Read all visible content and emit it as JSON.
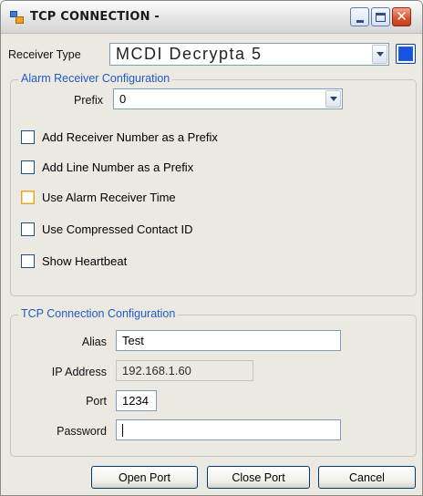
{
  "window": {
    "title": "TCP CONNECTION -",
    "icons": {
      "app": "app-window-icon",
      "minimize": "minimize-icon",
      "maximize": "maximize-icon",
      "close": "close-icon"
    }
  },
  "receiver_type": {
    "label": "Receiver Type",
    "value": "MCDI Decrypta 5",
    "color_button": "#1b5ee8"
  },
  "alarm_config": {
    "legend": "Alarm Receiver Configuration",
    "prefix_label": "Prefix",
    "prefix_value": "0",
    "checkboxes": [
      {
        "label": "Add Receiver Number as a Prefix",
        "checked": false
      },
      {
        "label": "Add Line Number as a Prefix",
        "checked": false
      },
      {
        "label": "Use Alarm Receiver Time",
        "checked": false
      },
      {
        "label": "Use Compressed Contact ID",
        "checked": false
      },
      {
        "label": "Show Heartbeat",
        "checked": false
      }
    ]
  },
  "tcp_config": {
    "legend": "TCP Connection Configuration",
    "alias_label": "Alias",
    "alias_value": "Test",
    "ip_label": "IP Address",
    "ip_value": "192.168.1.60",
    "port_label": "Port",
    "port_value": "1234",
    "password_label": "Password",
    "password_value": ""
  },
  "buttons": {
    "open_port": "Open Port",
    "close_port": "Close Port",
    "cancel": "Cancel"
  },
  "colors": {
    "window_bg": "#ebe9e2",
    "legend_text": "#2159c9",
    "input_border": "#7f9db9",
    "close_button": "#d6502c"
  }
}
